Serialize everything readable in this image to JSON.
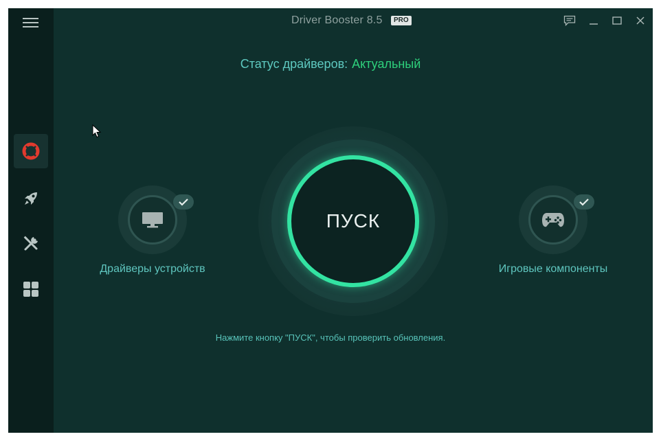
{
  "window": {
    "title": "Driver Booster 8.5",
    "badge": "PRO"
  },
  "sidebar": {
    "items": [
      {
        "name": "scan",
        "icon": "lifebuoy-icon",
        "active": true
      },
      {
        "name": "boost",
        "icon": "rocket-icon",
        "active": false
      },
      {
        "name": "tools",
        "icon": "tools-icon",
        "active": false
      },
      {
        "name": "action-center",
        "icon": "grid-icon",
        "active": false
      }
    ]
  },
  "status": {
    "label": "Статус драйверов:",
    "value": "Актуальный"
  },
  "scan_button": {
    "label": "ПУСК"
  },
  "features": {
    "left": {
      "label": "Драйверы устройств",
      "icon": "monitor-icon",
      "checked": true
    },
    "right": {
      "label": "Игровые компоненты",
      "icon": "gamepad-icon",
      "checked": true
    }
  },
  "hint": "Нажмите кнопку \"ПУСК\", чтобы проверить обновления.",
  "colors": {
    "background": "#0f302d",
    "sidebar": "#0a1f1d",
    "accent": "#33e3a2",
    "status_ok": "#2ed17c",
    "text_teal": "#5fc6bf",
    "scan_icon": "#e23a2e"
  }
}
